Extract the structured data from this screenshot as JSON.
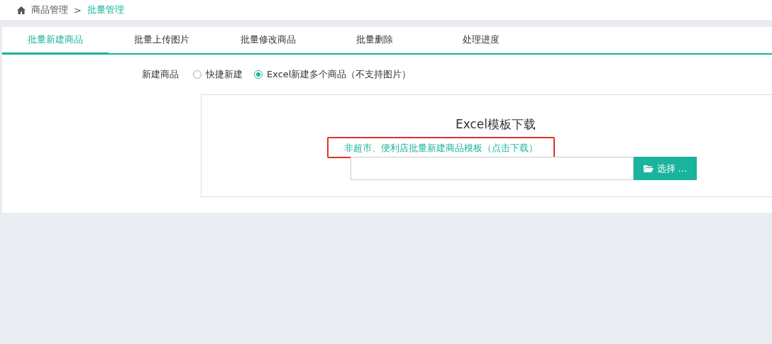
{
  "breadcrumb": {
    "items": [
      {
        "label": "商品管理",
        "selected": false
      },
      {
        "label": "批量管理",
        "selected": true
      }
    ],
    "separator": ">"
  },
  "tabs": [
    {
      "label": "批量新建商品",
      "selected": true
    },
    {
      "label": "批量上传图片",
      "selected": false
    },
    {
      "label": "批量修改商品",
      "selected": false
    },
    {
      "label": "批量删除",
      "selected": false
    },
    {
      "label": "处理进度",
      "selected": false
    }
  ],
  "form": {
    "label": "新建商品",
    "options": [
      {
        "label": "快捷新建",
        "selected": false
      },
      {
        "label": "Excel新建多个商品（不支持图片）",
        "selected": true
      }
    ]
  },
  "template": {
    "title": "Excel模板下载",
    "link": "非超市、便利店批量新建商品模板（点击下载）",
    "link_highlighted": true,
    "file_button": "选择 ..."
  }
}
